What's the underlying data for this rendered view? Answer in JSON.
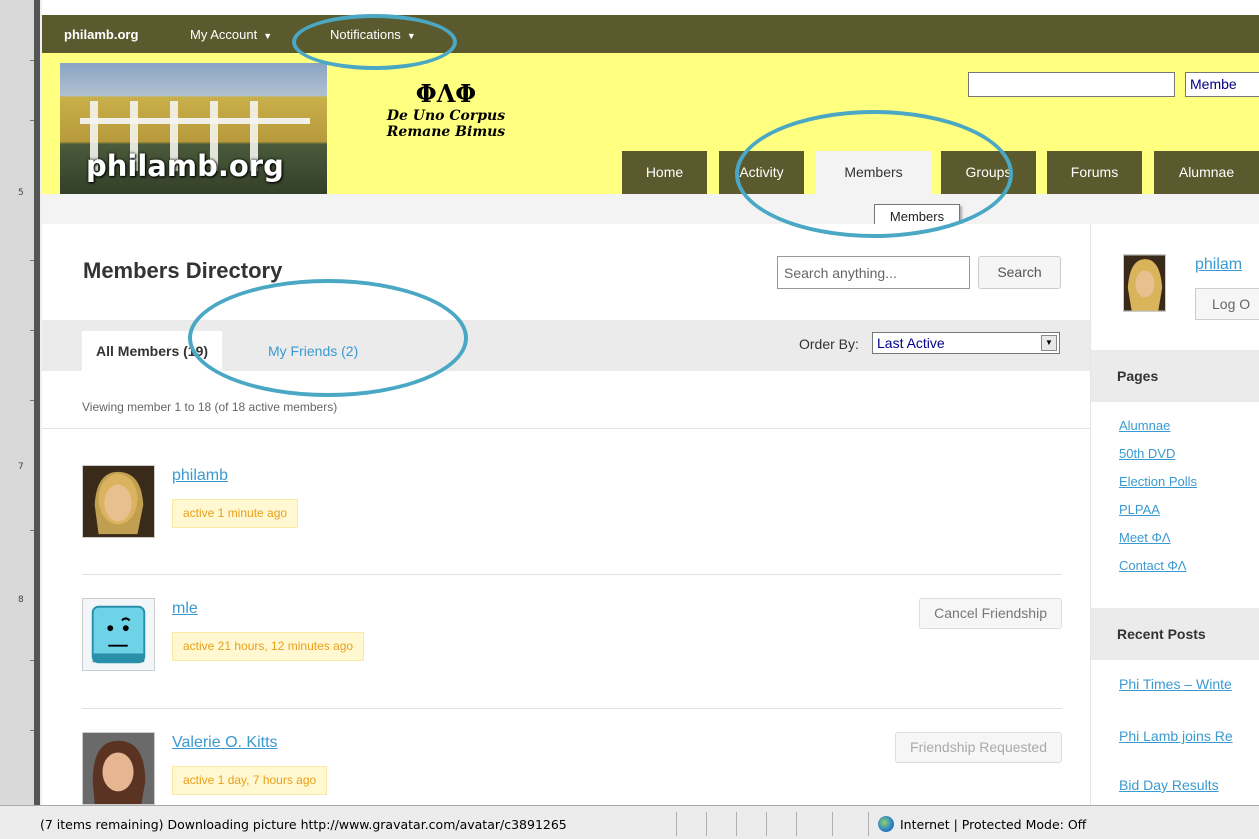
{
  "adminbar": {
    "site": "philamb.org",
    "account": "My Account",
    "notifications": "Notifications"
  },
  "header": {
    "site_name": "philamb.org",
    "greek": "ΦΛΦ",
    "motto_line1": "De Uno Corpus",
    "motto_line2": "Remane Bimus",
    "search_select": "Membe"
  },
  "nav": {
    "tabs": [
      "Home",
      "Activity",
      "Members",
      "Groups",
      "Forums",
      "Alumnae"
    ],
    "active": "Members",
    "tooltip": "Members"
  },
  "main": {
    "title": "Members Directory",
    "search_placeholder": "Search anything...",
    "search_button": "Search",
    "tab_all": "All Members (19)",
    "tab_friends": "My Friends (2)",
    "order_label": "Order By:",
    "order_value": "Last Active",
    "viewing": "Viewing member 1 to 18 (of 18 active members)",
    "members": [
      {
        "name": "philamb",
        "status": "active 1 minute ago",
        "action": ""
      },
      {
        "name": "mle",
        "status": "active 21 hours, 12 minutes ago",
        "action": "Cancel Friendship"
      },
      {
        "name": "Valerie O. Kitts",
        "status": "active 1 day, 7 hours ago",
        "action": "Friendship Requested"
      }
    ]
  },
  "sidebar": {
    "user": "philam",
    "logout": "Log O",
    "pages_title": "Pages",
    "pages": [
      "Alumnae",
      "50th DVD",
      "Election Polls",
      "PLPAA",
      "Meet ΦΛ",
      "Contact ΦΛ"
    ],
    "recent_title": "Recent Posts",
    "recent": [
      "Phi Times – Winte",
      "Phi Lamb joins Re",
      "Bid Day Results"
    ]
  },
  "statusbar": {
    "message": "(7 items remaining) Downloading picture http://www.gravatar.com/avatar/c3891265",
    "zone": "Internet | Protected Mode: Off"
  },
  "ruler": {
    "marks": [
      "5",
      "7",
      "8"
    ]
  },
  "colors": {
    "adminbar": "#5a5a2e",
    "header": "#ffff80",
    "link": "#3a9ad0",
    "status_bg": "#fff8d0",
    "status_text": "#e89f1c",
    "highlight_ring": "#4aa8c4"
  }
}
